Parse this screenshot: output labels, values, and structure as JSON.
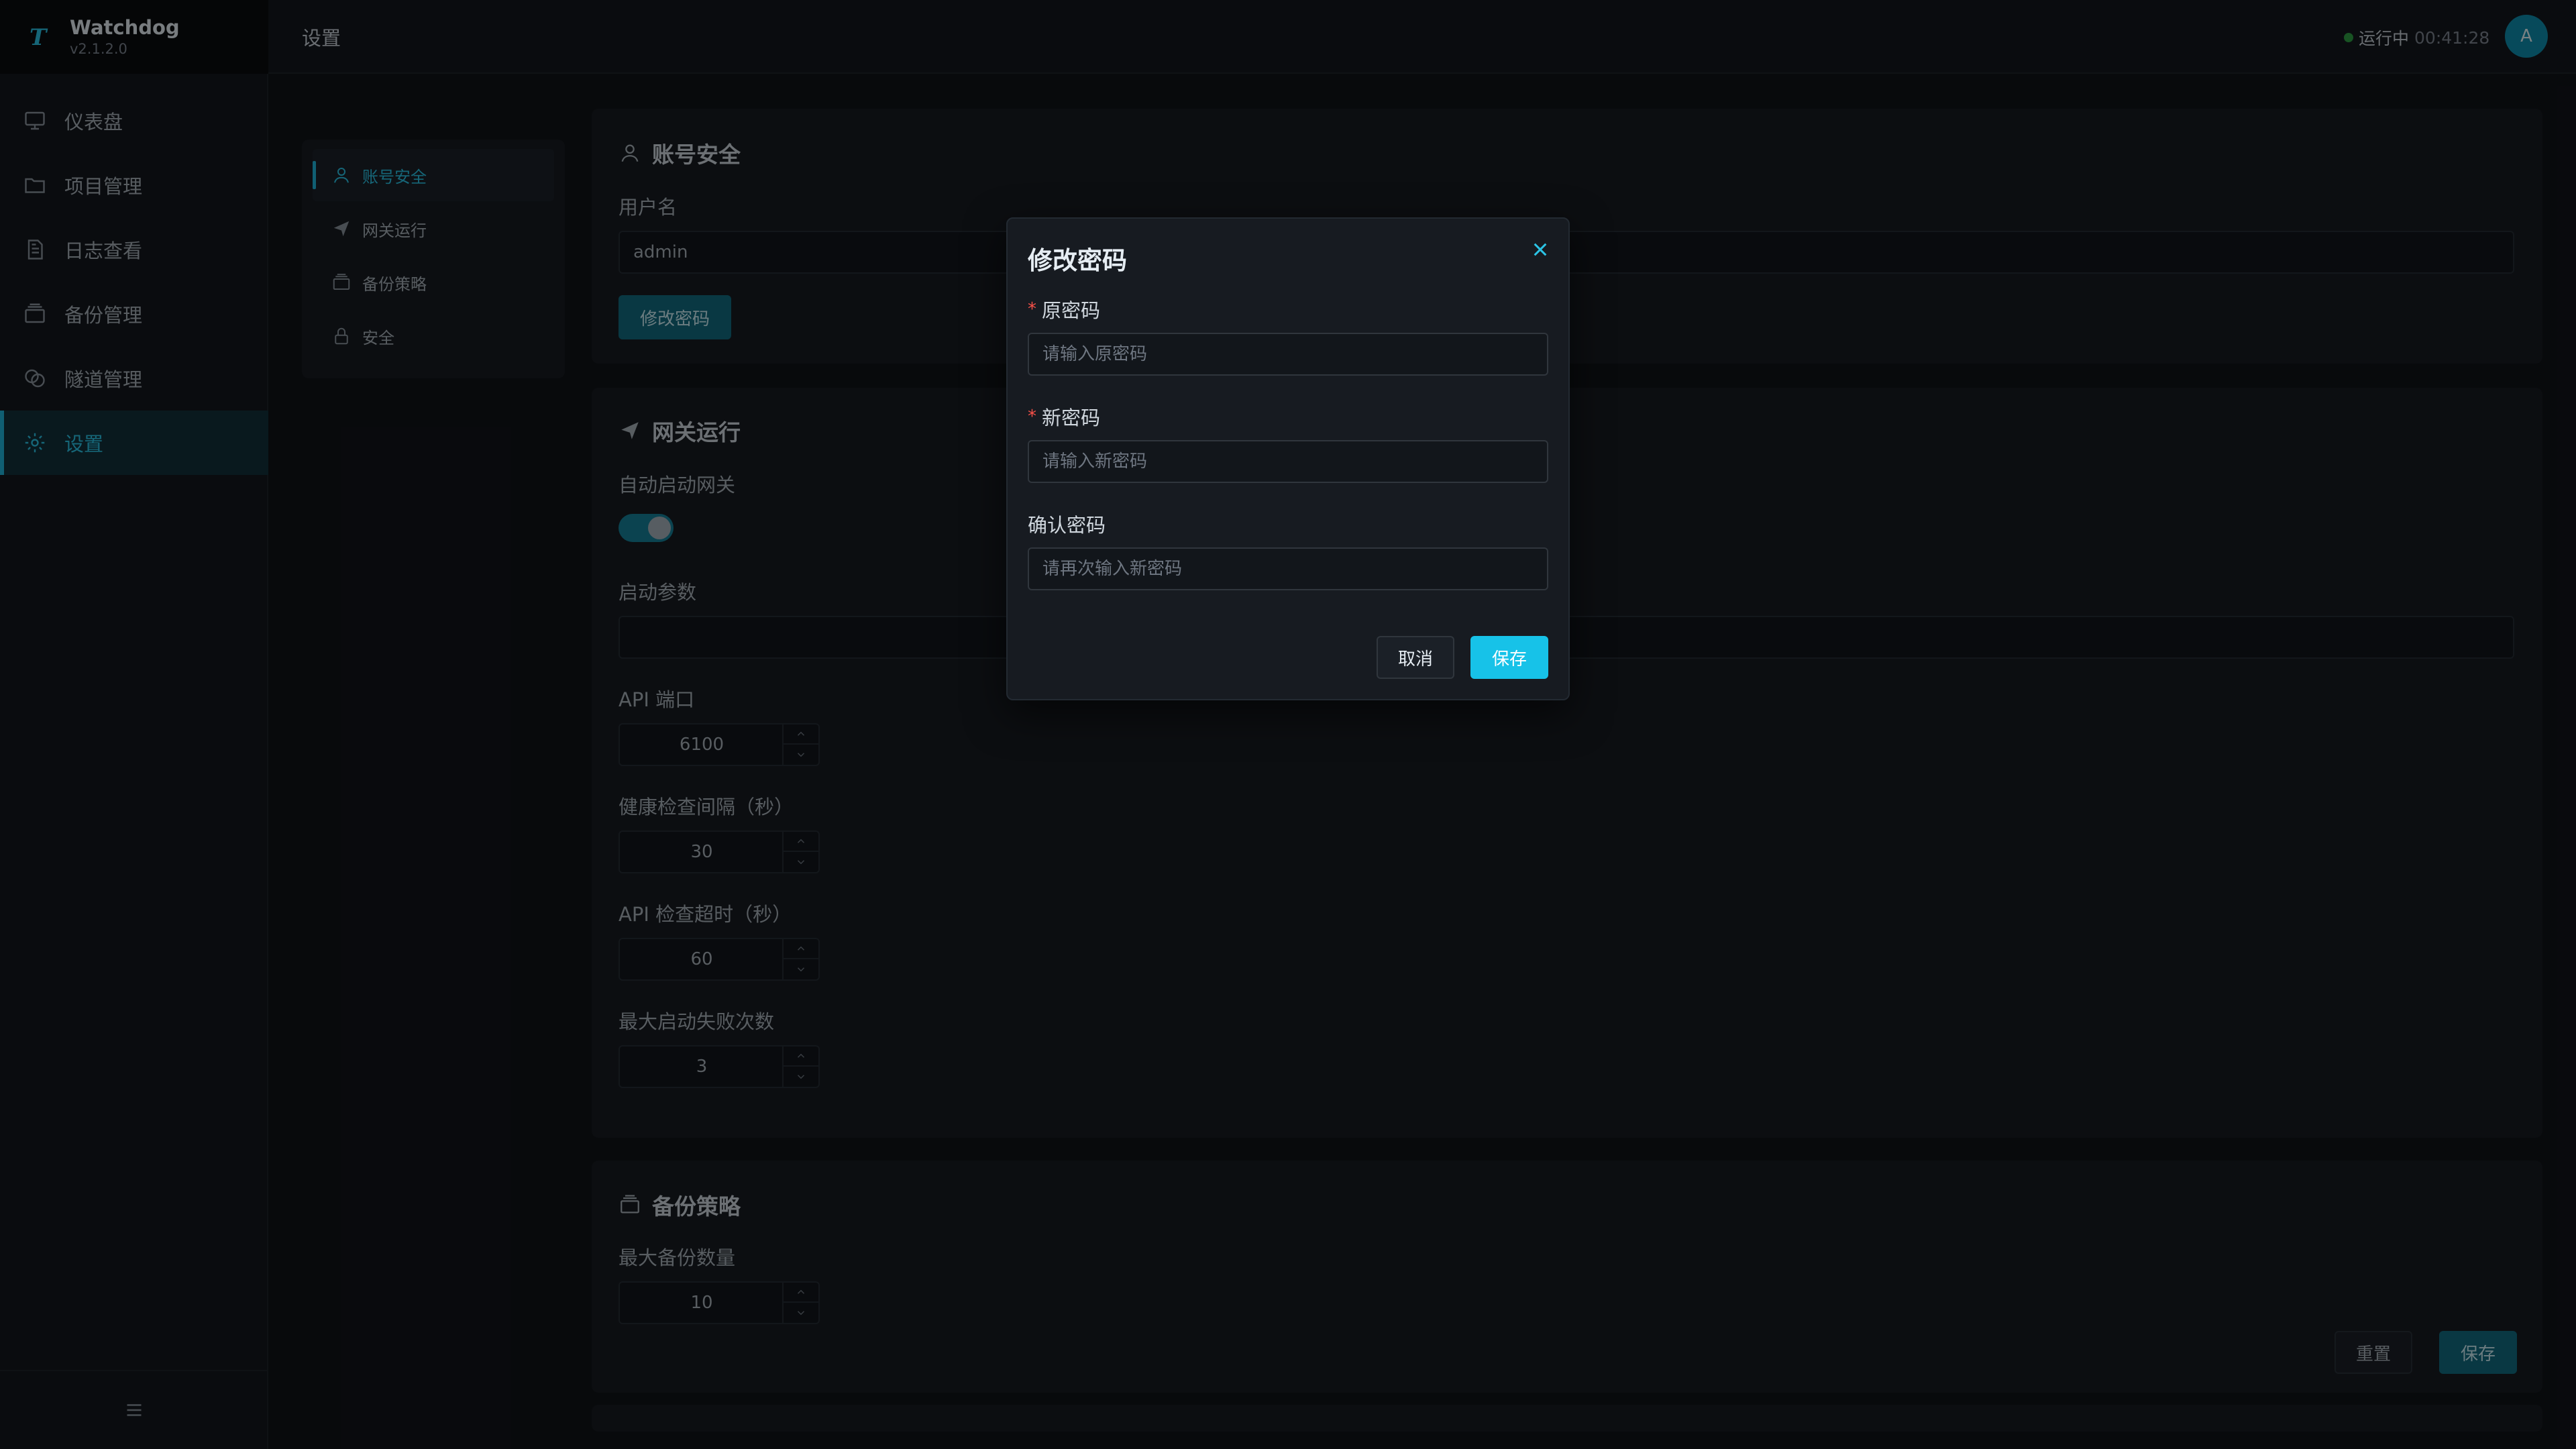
{
  "app": {
    "name": "Watchdog",
    "version": "v2.1.2.0",
    "logo_letter": "T"
  },
  "sidebar": {
    "items": [
      {
        "label": "仪表盘",
        "icon": "monitor-icon"
      },
      {
        "label": "项目管理",
        "icon": "folder-icon"
      },
      {
        "label": "日志查看",
        "icon": "document-icon"
      },
      {
        "label": "备份管理",
        "icon": "archive-icon"
      },
      {
        "label": "隧道管理",
        "icon": "tunnel-icon"
      },
      {
        "label": "设置",
        "icon": "gear-icon",
        "active": true
      }
    ],
    "collapse_icon": "menu-icon"
  },
  "header": {
    "title": "设置",
    "status_label": "运行中",
    "status_time": "00:41:28",
    "avatar_letter": "A"
  },
  "settings_nav": {
    "items": [
      {
        "label": "账号安全",
        "icon": "user-icon",
        "active": true
      },
      {
        "label": "网关运行",
        "icon": "send-icon"
      },
      {
        "label": "备份策略",
        "icon": "archive-icon"
      },
      {
        "label": "安全",
        "icon": "lock-icon"
      }
    ]
  },
  "account": {
    "title": "账号安全",
    "username_label": "用户名",
    "username_value": "admin",
    "change_password_button": "修改密码"
  },
  "gateway": {
    "title": "网关运行",
    "autostart_label": "自动启动网关",
    "autostart_on": true,
    "args_label": "启动参数",
    "args_value": "",
    "api_port_label": "API 端口",
    "api_port_value": "6100",
    "health_interval_label": "健康检查间隔（秒）",
    "health_interval_value": "30",
    "api_timeout_label": "API 检查超时（秒）",
    "api_timeout_value": "60",
    "max_fail_label": "最大启动失败次数",
    "max_fail_value": "3"
  },
  "backup": {
    "title": "备份策略",
    "max_count_label": "最大备份数量",
    "max_count_value": "10"
  },
  "footer_actions": {
    "reset": "重置",
    "save": "保存"
  },
  "modal": {
    "title": "修改密码",
    "old_password_label": "原密码",
    "old_password_placeholder": "请输入原密码",
    "new_password_label": "新密码",
    "new_password_placeholder": "请输入新密码",
    "confirm_password_label": "确认密码",
    "confirm_password_placeholder": "请再次输入新密码",
    "required_mark": "*",
    "cancel": "取消",
    "save": "保存"
  },
  "colors": {
    "accent": "#17c2e8",
    "accent_dim": "#126c80",
    "status_ok": "#2ea043",
    "required": "#f85149"
  }
}
